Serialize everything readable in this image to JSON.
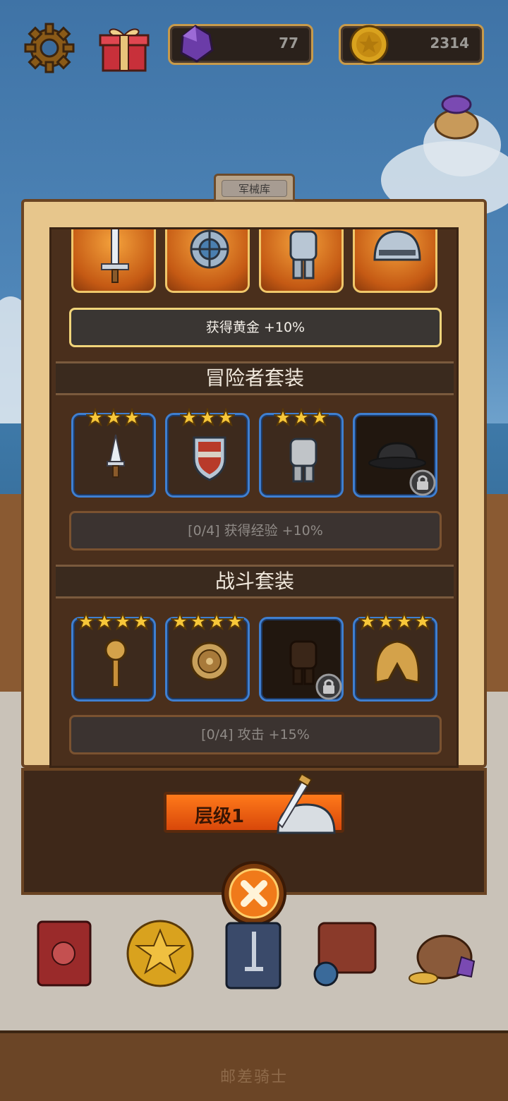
{
  "hud": {
    "settings_icon": "gear-icon",
    "gift_icon": "gift-icon",
    "gems": {
      "icon": "gem-icon",
      "value": "77"
    },
    "gold": {
      "icon": "coin-icon",
      "value": "2314"
    },
    "sack_icon": "sack-icon"
  },
  "panel": {
    "title": "军械库",
    "legendary_set": {
      "items": [
        {
          "icon": "sword-icon"
        },
        {
          "icon": "round-shield-icon"
        },
        {
          "icon": "armor-icon"
        },
        {
          "icon": "helmet-icon"
        }
      ],
      "bonus": "获得黄金 +10%"
    },
    "adventurer_set": {
      "title": "冒险者套装",
      "items": [
        {
          "icon": "dagger-icon",
          "stars": 3,
          "locked": false
        },
        {
          "icon": "shield-icon",
          "stars": 3,
          "locked": false
        },
        {
          "icon": "armor-icon",
          "stars": 3,
          "locked": false
        },
        {
          "icon": "cap-helmet-icon",
          "stars": 0,
          "locked": true
        }
      ],
      "bonus": "[0/4] 获得经验 +10%"
    },
    "battle_set": {
      "title": "战斗套装",
      "items": [
        {
          "icon": "mace-icon",
          "stars": 4,
          "locked": false
        },
        {
          "icon": "round-shield-icon",
          "stars": 4,
          "locked": false
        },
        {
          "icon": "armor-icon",
          "stars": 0,
          "locked": true
        },
        {
          "icon": "gold-helmet-icon",
          "stars": 4,
          "locked": false
        }
      ],
      "bonus": "[0/4] 攻击 +15%"
    }
  },
  "footer": {
    "level_label": "层级1",
    "close_icon": "close-icon"
  },
  "nav": [
    {
      "icon": "book-icon"
    },
    {
      "icon": "coin-icon"
    },
    {
      "icon": "card-sword-icon"
    },
    {
      "icon": "backpack-icon"
    },
    {
      "icon": "treasure-icon"
    }
  ],
  "bottom_label": "邮差骑士",
  "colors": {
    "gold_border": "#f0c76a",
    "blue_border": "#3f7fd0",
    "orange_button": "#ff7a1a"
  }
}
